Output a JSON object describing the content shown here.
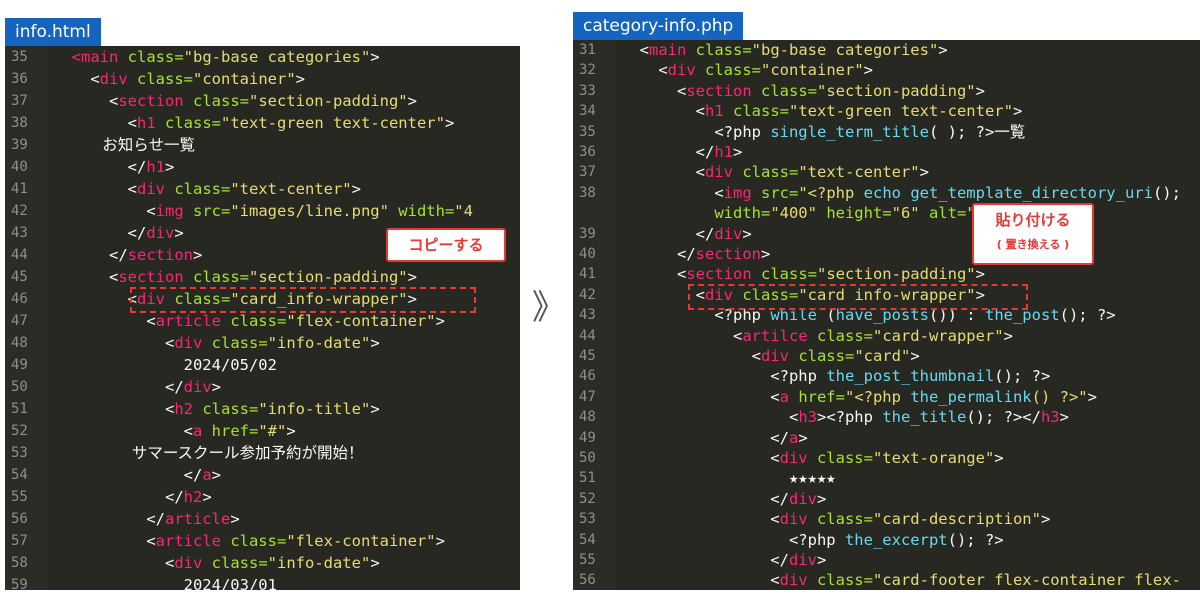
{
  "left": {
    "tab": "info.html",
    "callout": "コピーする",
    "lines": [
      {
        "n": "35",
        "t": [
          [
            "tag",
            "  <main"
          ],
          [
            "attr",
            " class="
          ],
          [
            "str",
            "\"bg-base categories\""
          ],
          [
            "txt",
            ">"
          ]
        ]
      },
      {
        "n": "36",
        "t": [
          [
            "txt",
            "    <"
          ],
          [
            "tag",
            "div"
          ],
          [
            "attr",
            " class="
          ],
          [
            "str",
            "\"container\""
          ],
          [
            "txt",
            ">"
          ]
        ]
      },
      {
        "n": "37",
        "t": [
          [
            "txt",
            "      <"
          ],
          [
            "tag",
            "section"
          ],
          [
            "attr",
            " class="
          ],
          [
            "str",
            "\"section-padding\""
          ],
          [
            "txt",
            ">"
          ]
        ]
      },
      {
        "n": "38",
        "t": [
          [
            "txt",
            "        <"
          ],
          [
            "tag",
            "h1"
          ],
          [
            "attr",
            " class="
          ],
          [
            "str",
            "\"text-green text-center\""
          ],
          [
            "txt",
            ">"
          ]
        ]
      },
      {
        "n": "39",
        "t": [
          [
            "jp",
            "          お知らせ一覧"
          ]
        ]
      },
      {
        "n": "40",
        "t": [
          [
            "txt",
            "        </"
          ],
          [
            "tag",
            "h1"
          ],
          [
            "txt",
            ">"
          ]
        ]
      },
      {
        "n": "41",
        "t": [
          [
            "txt",
            "        <"
          ],
          [
            "tag",
            "div"
          ],
          [
            "attr",
            " class="
          ],
          [
            "str",
            "\"text-center\""
          ],
          [
            "txt",
            ">"
          ]
        ]
      },
      {
        "n": "42",
        "t": [
          [
            "txt",
            "          <"
          ],
          [
            "tag",
            "img"
          ],
          [
            "attr",
            " src="
          ],
          [
            "str",
            "\"images/line.png\""
          ],
          [
            "attr",
            " width="
          ],
          [
            "str",
            "\"4"
          ]
        ]
      },
      {
        "n": "43",
        "t": [
          [
            "txt",
            "        </"
          ],
          [
            "tag",
            "div"
          ],
          [
            "txt",
            ">"
          ]
        ]
      },
      {
        "n": "44",
        "t": [
          [
            "txt",
            "      </"
          ],
          [
            "tag",
            "section"
          ],
          [
            "txt",
            ">"
          ]
        ]
      },
      {
        "n": "45",
        "t": [
          [
            "txt",
            "      <"
          ],
          [
            "tag",
            "section"
          ],
          [
            "attr",
            " class="
          ],
          [
            "str",
            "\"section-padding\""
          ],
          [
            "txt",
            ">"
          ]
        ]
      },
      {
        "n": "46",
        "t": [
          [
            "txt",
            "        <"
          ],
          [
            "tag",
            "div"
          ],
          [
            "attr",
            " class="
          ],
          [
            "str",
            "\"card_info-wrapper\""
          ],
          [
            "txt",
            ">"
          ]
        ]
      },
      {
        "n": "47",
        "t": [
          [
            "txt",
            "          <"
          ],
          [
            "tag",
            "article"
          ],
          [
            "attr",
            " class="
          ],
          [
            "str",
            "\"flex-container\""
          ],
          [
            "txt",
            ">"
          ]
        ]
      },
      {
        "n": "48",
        "t": [
          [
            "txt",
            "            <"
          ],
          [
            "tag",
            "div"
          ],
          [
            "attr",
            " class="
          ],
          [
            "str",
            "\"info-date\""
          ],
          [
            "txt",
            ">"
          ]
        ]
      },
      {
        "n": "49",
        "t": [
          [
            "txt",
            "              2024/05/02"
          ]
        ]
      },
      {
        "n": "50",
        "t": [
          [
            "txt",
            "            </"
          ],
          [
            "tag",
            "div"
          ],
          [
            "txt",
            ">"
          ]
        ]
      },
      {
        "n": "51",
        "t": [
          [
            "txt",
            "            <"
          ],
          [
            "tag",
            "h2"
          ],
          [
            "attr",
            " class="
          ],
          [
            "str",
            "\"info-title\""
          ],
          [
            "txt",
            ">"
          ]
        ]
      },
      {
        "n": "52",
        "t": [
          [
            "txt",
            "              <"
          ],
          [
            "tag",
            "a"
          ],
          [
            "attr",
            " href="
          ],
          [
            "str",
            "\"#\""
          ],
          [
            "txt",
            ">"
          ]
        ]
      },
      {
        "n": "53",
        "t": [
          [
            "jp",
            "                サマースクール参加予約が開始！"
          ]
        ]
      },
      {
        "n": "54",
        "t": [
          [
            "txt",
            "              </"
          ],
          [
            "tag",
            "a"
          ],
          [
            "txt",
            ">"
          ]
        ]
      },
      {
        "n": "55",
        "t": [
          [
            "txt",
            "            </"
          ],
          [
            "tag",
            "h2"
          ],
          [
            "txt",
            ">"
          ]
        ]
      },
      {
        "n": "56",
        "t": [
          [
            "txt",
            "          </"
          ],
          [
            "tag",
            "article"
          ],
          [
            "txt",
            ">"
          ]
        ]
      },
      {
        "n": "57",
        "t": [
          [
            "txt",
            "          <"
          ],
          [
            "tag",
            "article"
          ],
          [
            "attr",
            " class="
          ],
          [
            "str",
            "\"flex-container\""
          ],
          [
            "txt",
            ">"
          ]
        ]
      },
      {
        "n": "58",
        "t": [
          [
            "txt",
            "            <"
          ],
          [
            "tag",
            "div"
          ],
          [
            "attr",
            " class="
          ],
          [
            "str",
            "\"info-date\""
          ],
          [
            "txt",
            ">"
          ]
        ]
      },
      {
        "n": "59",
        "t": [
          [
            "txt",
            "              2024/03/01"
          ]
        ]
      }
    ]
  },
  "right": {
    "tab": "category-info.php",
    "callout_main": "貼り付ける",
    "callout_sub": "( 置き換える )",
    "lines": [
      {
        "n": "31",
        "t": [
          [
            "txt",
            "  <"
          ],
          [
            "tag",
            "main"
          ],
          [
            "attr",
            " class="
          ],
          [
            "str",
            "\"bg-base categories\""
          ],
          [
            "txt",
            ">"
          ]
        ]
      },
      {
        "n": "32",
        "t": [
          [
            "txt",
            "    <"
          ],
          [
            "tag",
            "div"
          ],
          [
            "attr",
            " class="
          ],
          [
            "str",
            "\"container\""
          ],
          [
            "txt",
            ">"
          ]
        ]
      },
      {
        "n": "33",
        "t": [
          [
            "txt",
            "      <"
          ],
          [
            "tag",
            "section"
          ],
          [
            "attr",
            " class="
          ],
          [
            "str",
            "\"section-padding\""
          ],
          [
            "txt",
            ">"
          ]
        ]
      },
      {
        "n": "34",
        "t": [
          [
            "txt",
            "        <"
          ],
          [
            "tag",
            "h1"
          ],
          [
            "attr",
            " class="
          ],
          [
            "str",
            "\"text-green text-center\""
          ],
          [
            "txt",
            ">"
          ]
        ]
      },
      {
        "n": "35",
        "t": [
          [
            "txt",
            "          <?php "
          ],
          [
            "fn",
            "single_term_title"
          ],
          [
            "txt",
            "( ); ?>"
          ],
          [
            "jp",
            "一覧"
          ]
        ]
      },
      {
        "n": "36",
        "t": [
          [
            "txt",
            "        </"
          ],
          [
            "tag",
            "h1"
          ],
          [
            "txt",
            ">"
          ]
        ]
      },
      {
        "n": "37",
        "t": [
          [
            "txt",
            "        <"
          ],
          [
            "tag",
            "div"
          ],
          [
            "attr",
            " class="
          ],
          [
            "str",
            "\"text-center\""
          ],
          [
            "txt",
            ">"
          ]
        ]
      },
      {
        "n": "38",
        "t": [
          [
            "txt",
            "          <"
          ],
          [
            "tag",
            "img"
          ],
          [
            "attr",
            " src="
          ],
          [
            "str",
            "\"<?php "
          ],
          [
            "fn",
            "echo get_template_directory_uri"
          ],
          [
            "txt",
            "();"
          ]
        ]
      },
      {
        "n": "",
        "t": [
          [
            "attr",
            "          width="
          ],
          [
            "str",
            "\"400\""
          ],
          [
            "attr",
            " height="
          ],
          [
            "str",
            "\"6\""
          ],
          [
            "attr",
            " alt="
          ],
          [
            "str",
            "\"\""
          ],
          [
            "txt",
            ">"
          ]
        ]
      },
      {
        "n": "39",
        "t": [
          [
            "txt",
            "        </"
          ],
          [
            "tag",
            "div"
          ],
          [
            "txt",
            ">"
          ]
        ]
      },
      {
        "n": "40",
        "t": [
          [
            "txt",
            "      </"
          ],
          [
            "tag",
            "section"
          ],
          [
            "txt",
            ">"
          ]
        ]
      },
      {
        "n": "41",
        "t": [
          [
            "txt",
            "      <"
          ],
          [
            "tag",
            "section"
          ],
          [
            "attr",
            " class="
          ],
          [
            "str",
            "\"section-padding\""
          ],
          [
            "txt",
            ">"
          ]
        ]
      },
      {
        "n": "42",
        "t": [
          [
            "txt",
            "        <"
          ],
          [
            "tag",
            "div"
          ],
          [
            "attr",
            " class="
          ],
          [
            "str",
            "\"card info-wrapper\""
          ],
          [
            "txt",
            ">"
          ]
        ]
      },
      {
        "n": "43",
        "t": [
          [
            "txt",
            "          <?php "
          ],
          [
            "fn",
            "while"
          ],
          [
            "txt",
            " ("
          ],
          [
            "fn",
            "have_posts"
          ],
          [
            "txt",
            "()) : "
          ],
          [
            "fn",
            "the_post"
          ],
          [
            "txt",
            "(); ?>"
          ]
        ]
      },
      {
        "n": "44",
        "t": [
          [
            "txt",
            "            <"
          ],
          [
            "tag",
            "artilce"
          ],
          [
            "attr",
            " class="
          ],
          [
            "str",
            "\"card-wrapper\""
          ],
          [
            "txt",
            ">"
          ]
        ]
      },
      {
        "n": "45",
        "t": [
          [
            "txt",
            "              <"
          ],
          [
            "tag",
            "div"
          ],
          [
            "attr",
            " class="
          ],
          [
            "str",
            "\"card\""
          ],
          [
            "txt",
            ">"
          ]
        ]
      },
      {
        "n": "46",
        "t": [
          [
            "txt",
            "                <?php "
          ],
          [
            "fn",
            "the_post_thumbnail"
          ],
          [
            "txt",
            "(); ?>"
          ]
        ]
      },
      {
        "n": "47",
        "t": [
          [
            "txt",
            "                <"
          ],
          [
            "tag",
            "a"
          ],
          [
            "attr",
            " href="
          ],
          [
            "str",
            "\"<?php "
          ],
          [
            "fn",
            "the_permalink"
          ],
          [
            "str",
            "() ?>\""
          ],
          [
            "txt",
            ">"
          ]
        ]
      },
      {
        "n": "48",
        "t": [
          [
            "txt",
            "                  <"
          ],
          [
            "tag",
            "h3"
          ],
          [
            "txt",
            "><?php "
          ],
          [
            "fn",
            "the_title"
          ],
          [
            "txt",
            "(); ?></"
          ],
          [
            "tag",
            "h3"
          ],
          [
            "txt",
            ">"
          ]
        ]
      },
      {
        "n": "49",
        "t": [
          [
            "txt",
            "                </"
          ],
          [
            "tag",
            "a"
          ],
          [
            "txt",
            ">"
          ]
        ]
      },
      {
        "n": "50",
        "t": [
          [
            "txt",
            "                <"
          ],
          [
            "tag",
            "div"
          ],
          [
            "attr",
            " class="
          ],
          [
            "str",
            "\"text-orange\""
          ],
          [
            "txt",
            ">"
          ]
        ]
      },
      {
        "n": "51",
        "t": [
          [
            "txt",
            "                  ★★★★★"
          ]
        ]
      },
      {
        "n": "52",
        "t": [
          [
            "txt",
            "                </"
          ],
          [
            "tag",
            "div"
          ],
          [
            "txt",
            ">"
          ]
        ]
      },
      {
        "n": "53",
        "t": [
          [
            "txt",
            "                <"
          ],
          [
            "tag",
            "div"
          ],
          [
            "attr",
            " class="
          ],
          [
            "str",
            "\"card-description\""
          ],
          [
            "txt",
            ">"
          ]
        ]
      },
      {
        "n": "54",
        "t": [
          [
            "txt",
            "                  <?php "
          ],
          [
            "fn",
            "the_excerpt"
          ],
          [
            "txt",
            "(); ?>"
          ]
        ]
      },
      {
        "n": "55",
        "t": [
          [
            "txt",
            "                </"
          ],
          [
            "tag",
            "div"
          ],
          [
            "txt",
            ">"
          ]
        ]
      },
      {
        "n": "56",
        "t": [
          [
            "txt",
            "                <"
          ],
          [
            "tag",
            "div"
          ],
          [
            "attr",
            " class="
          ],
          [
            "str",
            "\"card-footer flex-container flex-"
          ]
        ]
      }
    ]
  },
  "arrow_glyph": "》"
}
